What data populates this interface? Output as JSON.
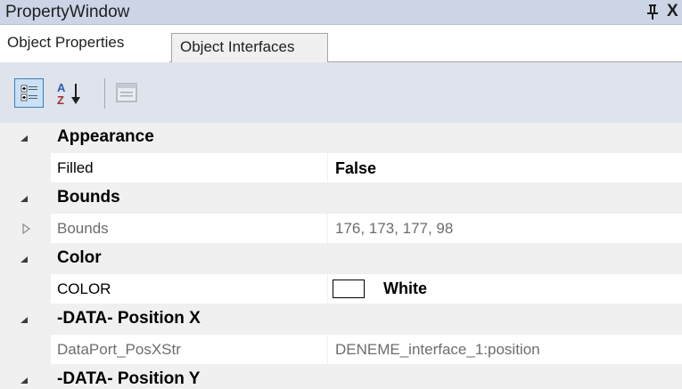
{
  "window": {
    "title": "PropertyWindow",
    "pin_icon": "pin-icon",
    "close_glyph": "X"
  },
  "tabs": [
    {
      "label": "Object Properties",
      "active": true
    },
    {
      "label": "Object Interfaces",
      "active": false
    }
  ],
  "toolbar": {
    "categorized": {
      "icon": "categorized-icon",
      "pressed": true
    },
    "alphabetical": {
      "icon": "sort-alphabetical-icon",
      "glyph_a": "A",
      "glyph_z": "Z"
    },
    "property_pages": {
      "icon": "property-pages-icon",
      "enabled": false
    }
  },
  "grid": {
    "categories": [
      {
        "label": "Appearance",
        "expanded": true,
        "properties": [
          {
            "name": "Filled",
            "value": "False",
            "readonly": false
          }
        ]
      },
      {
        "label": "Bounds",
        "expanded": true,
        "properties": [
          {
            "name": "Bounds",
            "value": "176, 173, 177, 98",
            "readonly": true,
            "expandable": true
          }
        ]
      },
      {
        "label": "Color",
        "expanded": true,
        "properties": [
          {
            "name": "COLOR",
            "value": "White",
            "readonly": false,
            "swatch": "#ffffff"
          }
        ]
      },
      {
        "label": "-DATA- Position X",
        "expanded": true,
        "properties": [
          {
            "name": "DataPort_PosXStr",
            "value": "DENEME_interface_1:position",
            "readonly": true
          }
        ]
      },
      {
        "label": "-DATA- Position Y",
        "expanded": true,
        "properties": []
      }
    ]
  },
  "colors": {
    "titlebar": "#cbd5e6",
    "toolbar": "#dfe3ec",
    "category_bg": "#f0f0f0",
    "readonly_text": "#6d6d6d",
    "selected_button_border": "#3c7fb1"
  }
}
